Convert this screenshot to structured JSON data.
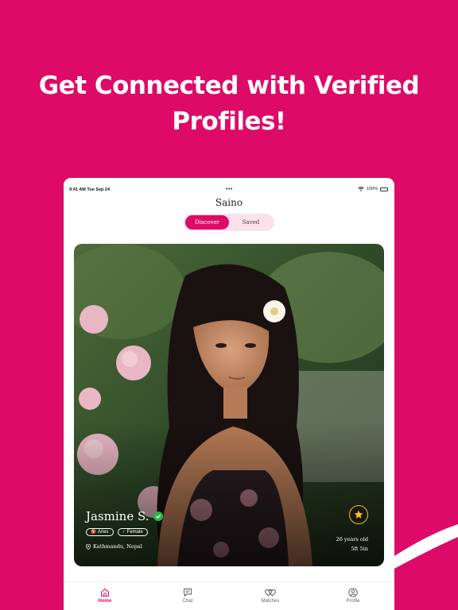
{
  "headline": {
    "line1": "Get Connected with Verified",
    "line2": "Profiles!"
  },
  "colors": {
    "brand": "#DE0A67",
    "segment_bg": "#FCE1EC",
    "verified": "#2BB34A",
    "star": "#F5C518"
  },
  "status_bar": {
    "time": "9:41 AM  Tue Sep 24",
    "dots": "•••",
    "battery": "100%"
  },
  "app": {
    "title": "Saino"
  },
  "segments": {
    "discover": "Discover",
    "saved": "Saved"
  },
  "profile": {
    "name": "Jasmine S.",
    "tags": [
      {
        "icon": "aries-icon",
        "label": "Aries"
      },
      {
        "icon": "female-icon",
        "label": "Female"
      }
    ],
    "location": "Kathmandu, Nepal",
    "age": "26 years old",
    "height": "5ft 5in"
  },
  "tabs": [
    {
      "label": "Home",
      "icon": "home-icon",
      "active": true
    },
    {
      "label": "Chat",
      "icon": "chat-icon"
    },
    {
      "label": "Matches",
      "icon": "hearts-icon"
    },
    {
      "label": "Profile",
      "icon": "user-icon"
    }
  ]
}
